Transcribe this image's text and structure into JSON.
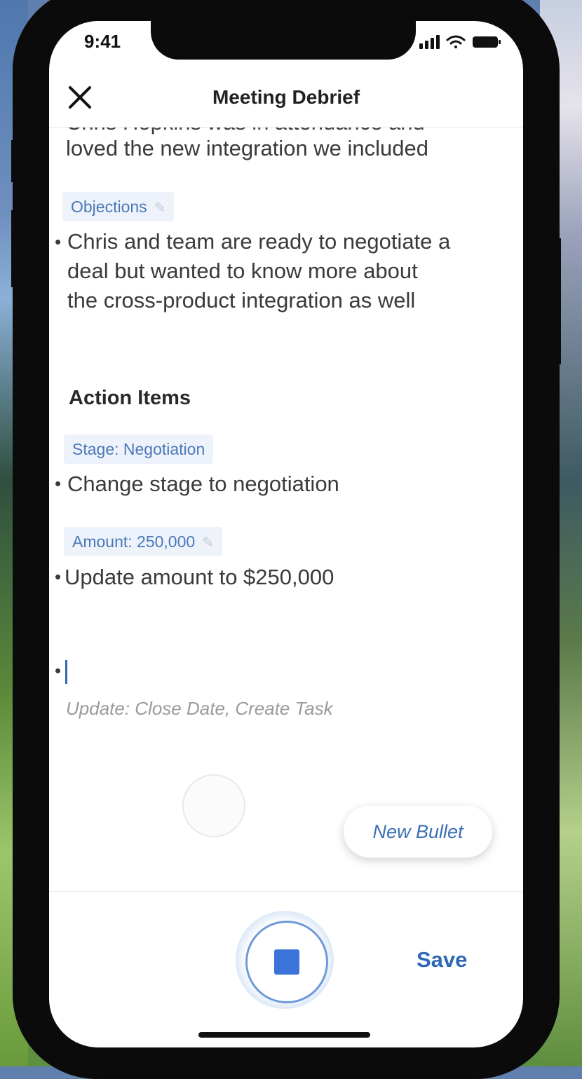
{
  "status_bar": {
    "time": "9:41"
  },
  "header": {
    "title": "Meeting Debrief",
    "close_icon": "close-icon"
  },
  "notes": {
    "clipped_line": "Chris Hopkins was in attendance and",
    "line_integration": "loved the new integration we included",
    "objections_chip": "Objections",
    "objection_lines": [
      "Chris and team are ready to negotiate a",
      "deal but wanted to know more about",
      "the cross-product integration as well"
    ],
    "action_items_heading": "Action Items",
    "stage_chip": "Stage: Negotiation",
    "stage_line": "Change stage to negotiation",
    "amount_chip": "Amount: 250,000",
    "amount_line": "Update amount to $250,000",
    "bullet_char": "•",
    "hint": "Update: Close Date, Create Task"
  },
  "actions": {
    "new_bullet": "New Bullet",
    "save": "Save"
  },
  "colors": {
    "accent": "#2f67b4",
    "chip_bg": "#eef3fb",
    "stop_button": "#3b74d8"
  }
}
